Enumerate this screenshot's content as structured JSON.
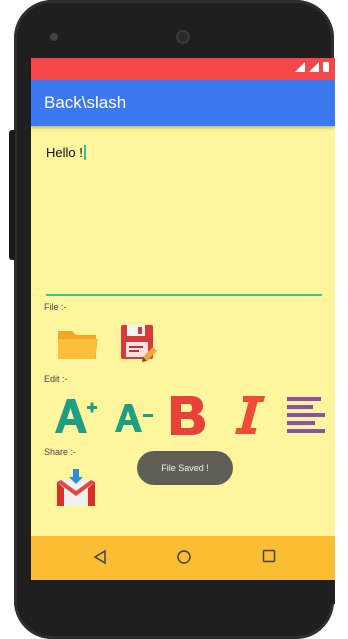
{
  "app": {
    "title": "Back\\slash"
  },
  "editor": {
    "text": "Hello !"
  },
  "sections": {
    "file_label": "File :-",
    "edit_label": "Edit :-",
    "share_label": "Share :-"
  },
  "toast": {
    "text": "File Saved !"
  },
  "icons": {
    "open": "folder-icon",
    "save": "floppy-disk-icon",
    "increase_font": "font-increase-icon",
    "decrease_font": "font-decrease-icon",
    "bold": "bold-icon",
    "italic": "italic-icon",
    "align": "align-lines-icon",
    "share_gmail": "gmail-icon"
  },
  "colors": {
    "status_bar": "#f44747",
    "app_bar": "#3b78f0",
    "background": "#fff59d",
    "nav_bar": "#fbbd32",
    "accent": "#2ec4a0"
  }
}
